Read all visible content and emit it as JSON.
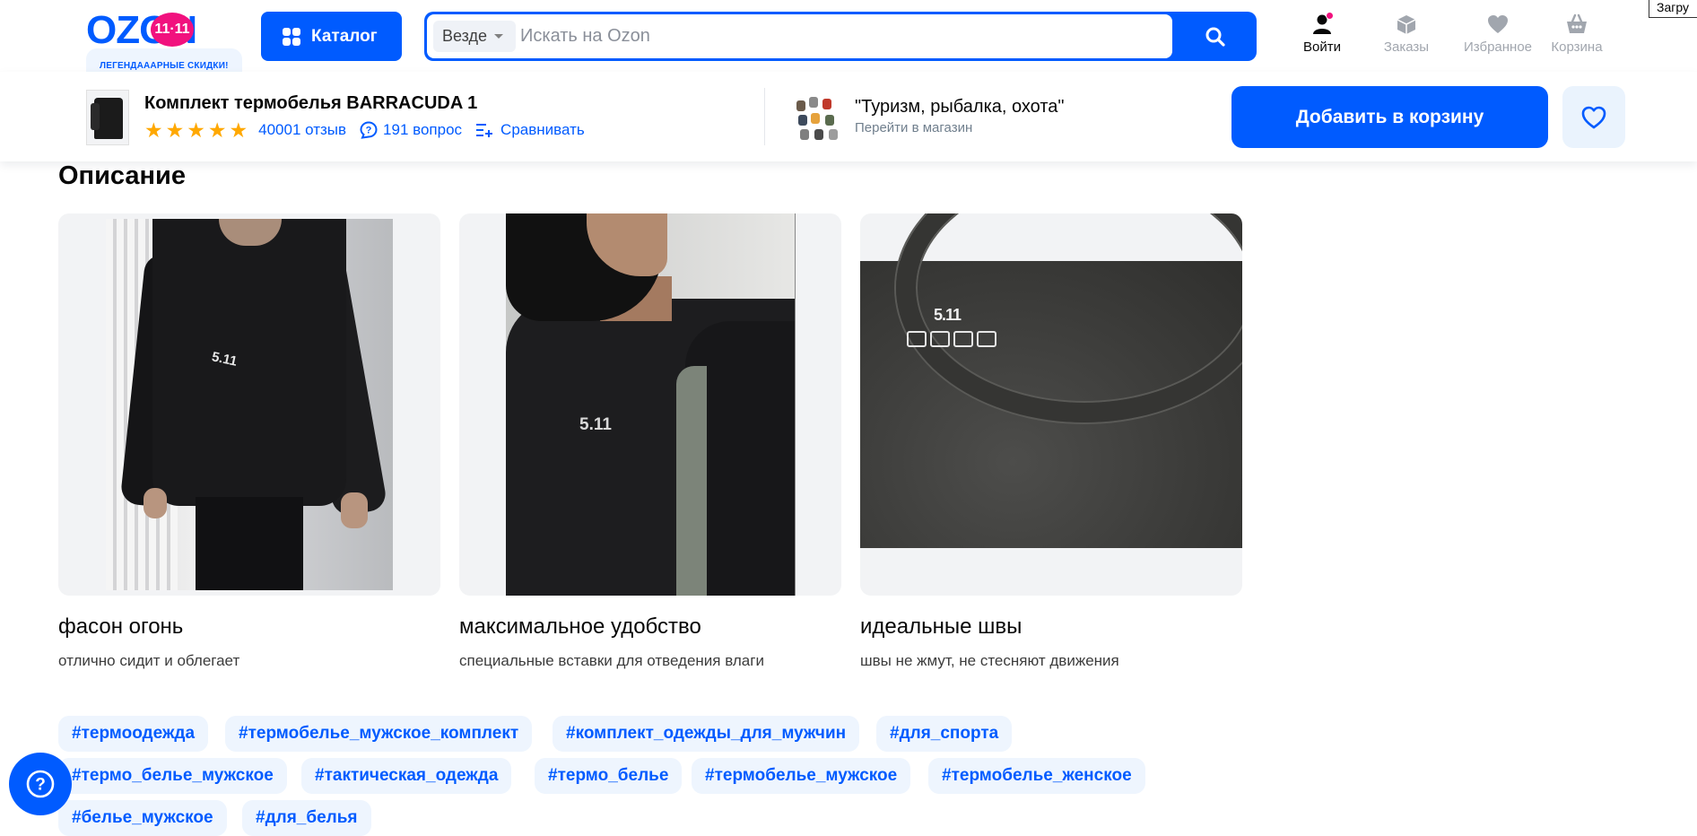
{
  "header": {
    "logo_text": "OZON",
    "logo_badge": "11·11",
    "logo_tagline": "ЛЕГЕНДАААРНЫЕ СКИДКИ!",
    "catalog_label": "Каталог",
    "search": {
      "scope": "Везде",
      "placeholder": "Искать на Ozon",
      "value": ""
    },
    "nav": [
      {
        "label": "Войти",
        "icon": "user-icon"
      },
      {
        "label": "Заказы",
        "icon": "box-icon"
      },
      {
        "label": "Избранное",
        "icon": "heart-icon"
      },
      {
        "label": "Корзина",
        "icon": "basket-icon"
      }
    ],
    "loading_text": "Загру"
  },
  "product_bar": {
    "title": "Комплект термобелья BARRACUDA 1",
    "rating_stars": 5,
    "reviews": "40001 отзыв",
    "questions": "191 вопрос",
    "compare": "Сравнивать",
    "shop_name": "\"Туризм, рыбалка, охота\"",
    "shop_link": "Перейти в магазин",
    "add_to_cart": "Добавить в корзину"
  },
  "description": {
    "heading": "Описание",
    "cards": [
      {
        "title": "фасон огонь",
        "subtitle": "отлично сидит и облегает"
      },
      {
        "title": "максимальное удобство",
        "subtitle": "специальные вставки для отведения влаги"
      },
      {
        "title": "идеальные швы",
        "subtitle": "швы не жмут, не стесняют движения"
      }
    ],
    "photo_text": "5.11"
  },
  "tags": [
    "#термоодежда",
    "#термобелье_мужское_комплект",
    "#комплект_одежды_для_мужчин",
    "#для_спорта",
    "#термо_белье_мужское",
    "#тактическая_одежда",
    "#термо_белье",
    "#термобелье_мужское",
    "#термобелье_женское",
    "#белье_мужское",
    "#для_белья"
  ],
  "colors": {
    "brand": "#005bff",
    "accent_pink": "#f1117e",
    "star": "#ffa800",
    "tag_bg": "#eef5fe"
  }
}
